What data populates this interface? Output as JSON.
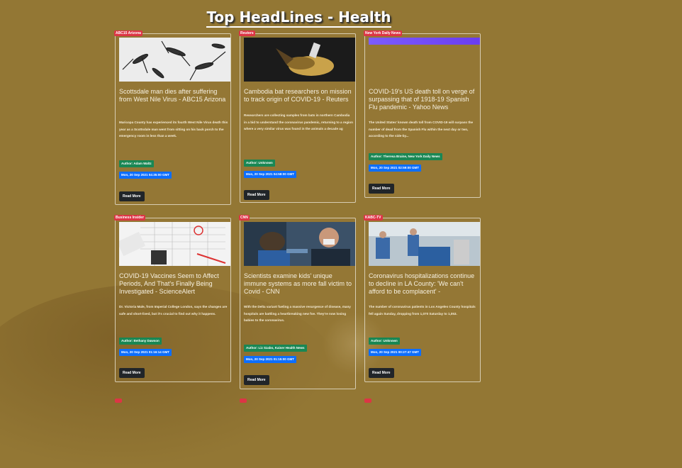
{
  "page": {
    "title": "Top HeadLines - Health"
  },
  "articles": [
    {
      "source": "ABC15 Arizona",
      "headline": "Scottsdale man dies after suffering from West Nile Virus - ABC15 Arizona",
      "description": "Maricopa County has experienced its fourth West Nile Virus death this year as a Scottsdale man went from sitting on his back porch to the emergency room in less than a week.",
      "author": "Author: Adam Waltz",
      "date": "Mon, 20 Sep 2021 04:35:00 GMT",
      "button": "Read More",
      "image": "mosquitoes-image"
    },
    {
      "source": "Reuters",
      "headline": "Cambodia bat researchers on mission to track origin of COVID-19 - Reuters",
      "description": "Researchers are collecting samples from bats in northern Cambodia in a bid to understand the coronavirus pandemic, returning to a region where a very similar virus was found in the animals a decade ag",
      "author": "Author: Unknown",
      "date": "Mon, 20 Sep 2021 04:58:00 GMT",
      "button": "Read More",
      "image": "bat-image"
    },
    {
      "source": "New York Daily News",
      "headline": "COVID-19's US death toll on verge of surpassing that of 1918-19 Spanish Flu pandemic - Yahoo News",
      "description": "The United States' known death toll from COVID-19 will surpass the number of dead from the Spanish Flu within the next day or two, according to the side-by...",
      "author": "Author: Theresa Braine, New York Daily News",
      "date": "Mon, 20 Sep 2021 02:59:00 GMT",
      "button": "Read More",
      "image": "purple-banner"
    },
    {
      "source": "Business Insider",
      "headline": "COVID-19 Vaccines Seem to Affect Periods, And That's Finally Being Investigated - ScienceAlert",
      "description": "Dr. Victoria Male, from Imperial College London, says the changes are safe and short-lived, but it's crucial to find out why it happens.",
      "author": "Author: Bethany Dawson",
      "date": "Mon, 20 Sep 2021 01:16:14 GMT",
      "button": "Read More",
      "image": "calendar-image"
    },
    {
      "source": "CNN",
      "headline": "Scientists examine kids' unique immune systems as more fall victim to Covid - CNN",
      "description": "With the Delta variant fueling a massive resurgence of disease, many hospitals are battling a heartbreaking new foe. They're now losing babies to the coronavirus.",
      "author": "Author: Liz Szabo, Kaiser Health News",
      "date": "Mon, 20 Sep 2021 01:15:00 GMT",
      "button": "Read More",
      "image": "lab-image"
    },
    {
      "source": "KABC-TV",
      "headline": "Coronavirus hospitalizations continue to decline in LA County: 'We can't afford to be complacent' -",
      "description": "The number of coronavirus patients in Los Angeles County hospitals fell again Sunday, dropping from 1,070 Saturday to 1,053.",
      "author": "Author: Unknown",
      "date": "Mon, 20 Sep 2021 00:27:47 GMT",
      "button": "Read More",
      "image": "hospital-image"
    }
  ],
  "colors": {
    "background": "#937734",
    "source_badge": "#dc3545",
    "author_badge": "#198754",
    "date_badge": "#0d6efd",
    "button": "#212529"
  }
}
